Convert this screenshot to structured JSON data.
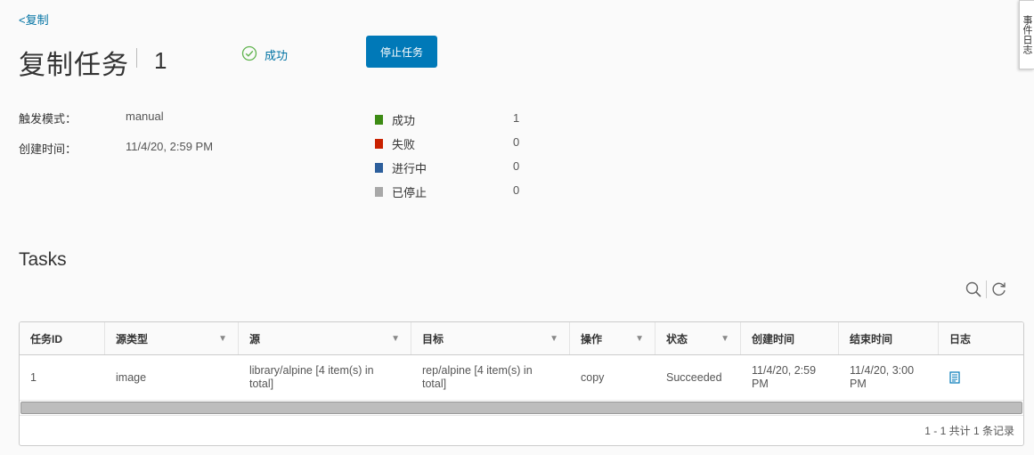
{
  "nav": {
    "back_label": "<复制"
  },
  "header": {
    "title": "复制任务",
    "job_id": "1",
    "status_label": "成功",
    "stop_button": "停止任务"
  },
  "details": {
    "trigger_label": "触发模式：",
    "trigger_value": "manual",
    "created_label": "创建时间：",
    "created_value": "11/4/20, 2:59 PM"
  },
  "summary": [
    {
      "label": "成功",
      "count": "1",
      "color": "#3d8b14"
    },
    {
      "label": "失败",
      "count": "0",
      "color": "#c92100"
    },
    {
      "label": "进行中",
      "count": "0",
      "color": "#2d5f9c"
    },
    {
      "label": "已停止",
      "count": "0",
      "color": "#a8a8a8"
    }
  ],
  "tasks": {
    "title": "Tasks",
    "toolbar": {
      "search_icon": "search-icon",
      "refresh_icon": "refresh-icon"
    },
    "columns": [
      "任务ID",
      "源类型",
      "源",
      "目标",
      "操作",
      "状态",
      "创建时间",
      "结束时间",
      "日志"
    ],
    "rows": [
      [
        "1",
        "image",
        "library/alpine [4 item(s) in total]",
        "rep/alpine [4 item(s) in total]",
        "copy",
        "Succeeded",
        "11/4/20, 2:59 PM",
        "11/4/20, 3:00 PM",
        ""
      ]
    ],
    "footer": "1 - 1 共计 1 条记录"
  },
  "side_tab": "事件日志"
}
